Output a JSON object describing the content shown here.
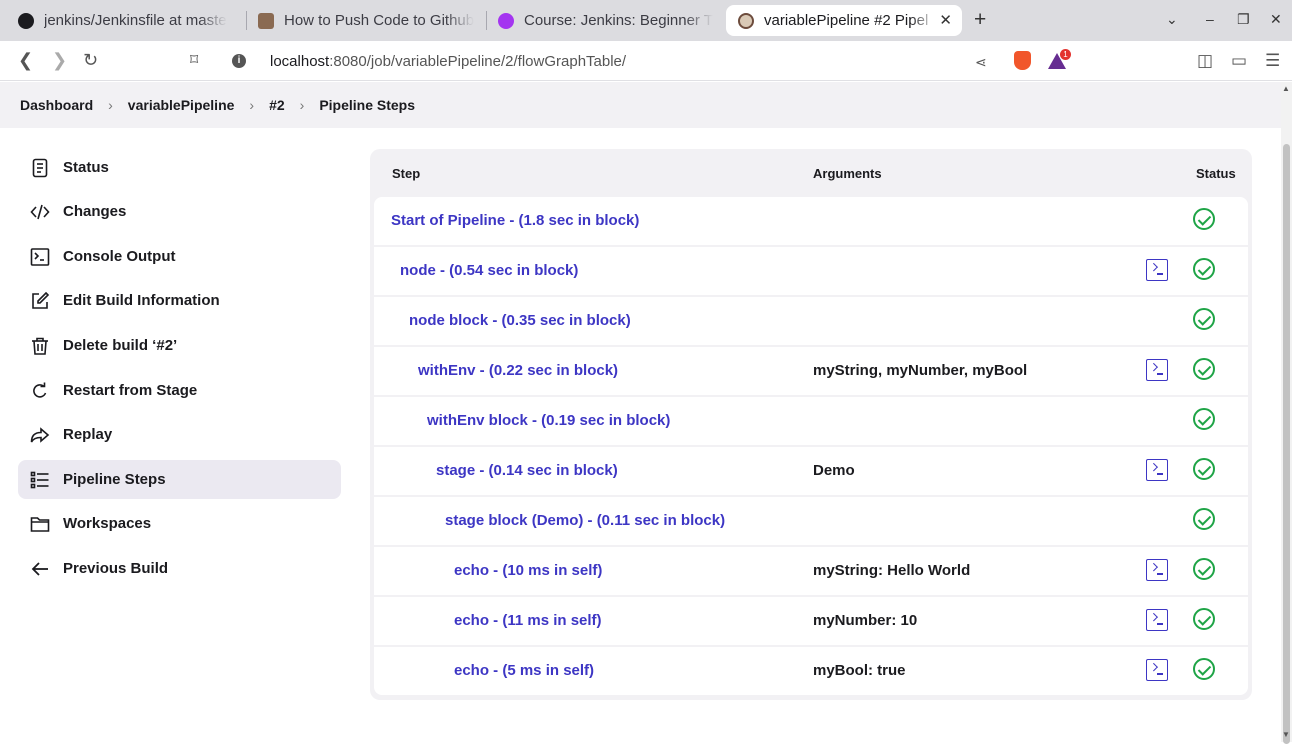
{
  "browser": {
    "tabs": [
      {
        "title": "jenkins/Jenkinsfile at maste",
        "icon": "github-icon"
      },
      {
        "title": "How to Push Code to Github",
        "icon": "avatar-icon"
      },
      {
        "title": "Course: Jenkins: Beginner T",
        "icon": "udemy-icon"
      },
      {
        "title": "variablePipeline #2 Pipel",
        "icon": "jenkins-icon",
        "active": true
      }
    ],
    "url_host": "localhost",
    "url_path": ":8080/job/variablePipeline/2/flowGraphTable/",
    "rewards_badge": "1"
  },
  "breadcrumb": [
    "Dashboard",
    "variablePipeline",
    "#2",
    "Pipeline Steps"
  ],
  "sidebar": {
    "items": [
      {
        "label": "Status",
        "icon": "document-icon"
      },
      {
        "label": "Changes",
        "icon": "code-icon"
      },
      {
        "label": "Console Output",
        "icon": "terminal-icon"
      },
      {
        "label": "Edit Build Information",
        "icon": "edit-icon"
      },
      {
        "label": "Delete build ‘#2’",
        "icon": "trash-icon"
      },
      {
        "label": "Restart from Stage",
        "icon": "restart-icon"
      },
      {
        "label": "Replay",
        "icon": "replay-icon"
      },
      {
        "label": "Pipeline Steps",
        "icon": "list-icon",
        "active": true
      },
      {
        "label": "Workspaces",
        "icon": "folder-icon"
      },
      {
        "label": "Previous Build",
        "icon": "arrow-left-icon"
      }
    ]
  },
  "table": {
    "headers": {
      "step": "Step",
      "arguments": "Arguments",
      "status": "Status"
    },
    "rows": [
      {
        "step": "Start of Pipeline - (1.8 sec in block)",
        "depth": 0,
        "args": "",
        "console": false,
        "status": "success"
      },
      {
        "step": "node - (0.54 sec in block)",
        "depth": 1,
        "args": "",
        "console": true,
        "status": "success"
      },
      {
        "step": "node block - (0.35 sec in block)",
        "depth": 2,
        "args": "",
        "console": false,
        "status": "success"
      },
      {
        "step": "withEnv - (0.22 sec in block)",
        "depth": 3,
        "args": "myString, myNumber, myBool",
        "console": true,
        "status": "success"
      },
      {
        "step": "withEnv block - (0.19 sec in block)",
        "depth": 4,
        "args": "",
        "console": false,
        "status": "success"
      },
      {
        "step": "stage - (0.14 sec in block)",
        "depth": 5,
        "args": "Demo",
        "console": true,
        "status": "success"
      },
      {
        "step": "stage block (Demo) - (0.11 sec in block)",
        "depth": 6,
        "args": "",
        "console": false,
        "status": "success"
      },
      {
        "step": "echo - (10 ms in self)",
        "depth": 7,
        "args": "myString: Hello World",
        "console": true,
        "status": "success"
      },
      {
        "step": "echo - (11 ms in self)",
        "depth": 7,
        "args": "myNumber: 10",
        "console": true,
        "status": "success"
      },
      {
        "step": "echo - (5 ms in self)",
        "depth": 7,
        "args": "myBool: true",
        "console": true,
        "status": "success"
      }
    ]
  },
  "colors": {
    "link": "#3d36c4",
    "success": "#1ea446",
    "active_bg": "#ebe9f1"
  }
}
